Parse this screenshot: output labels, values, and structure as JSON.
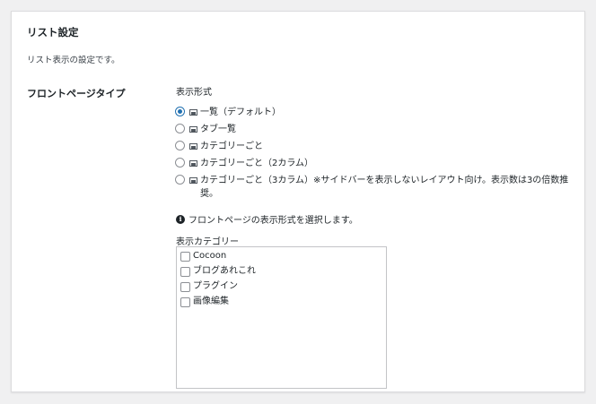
{
  "section": {
    "title": "リスト設定",
    "description": "リスト表示の設定です。"
  },
  "front_page_type": {
    "label": "フロントページタイプ",
    "display_format_label": "表示形式",
    "options": [
      {
        "label": "一覧（デフォルト）",
        "checked": true
      },
      {
        "label": "タブ一覧",
        "checked": false
      },
      {
        "label": "カテゴリーごと",
        "checked": false
      },
      {
        "label": "カテゴリーごと（2カラム）",
        "checked": false
      },
      {
        "label": "カテゴリーごと（3カラム）※サイドバーを表示しないレイアウト向け。表示数は3の倍数推奨。",
        "checked": false
      }
    ],
    "info_text": "フロントページの表示形式を選択します。",
    "category_label": "表示カテゴリー",
    "categories": [
      "Cocoon",
      "ブログあれこれ",
      "プラグイン",
      "画像編集"
    ]
  },
  "icons": {
    "option_icon": "image-icon",
    "info_icon": "info-icon"
  },
  "colors": {
    "accent": "#2271b1",
    "background": "#f0f0f1",
    "panel": "#ffffff"
  }
}
